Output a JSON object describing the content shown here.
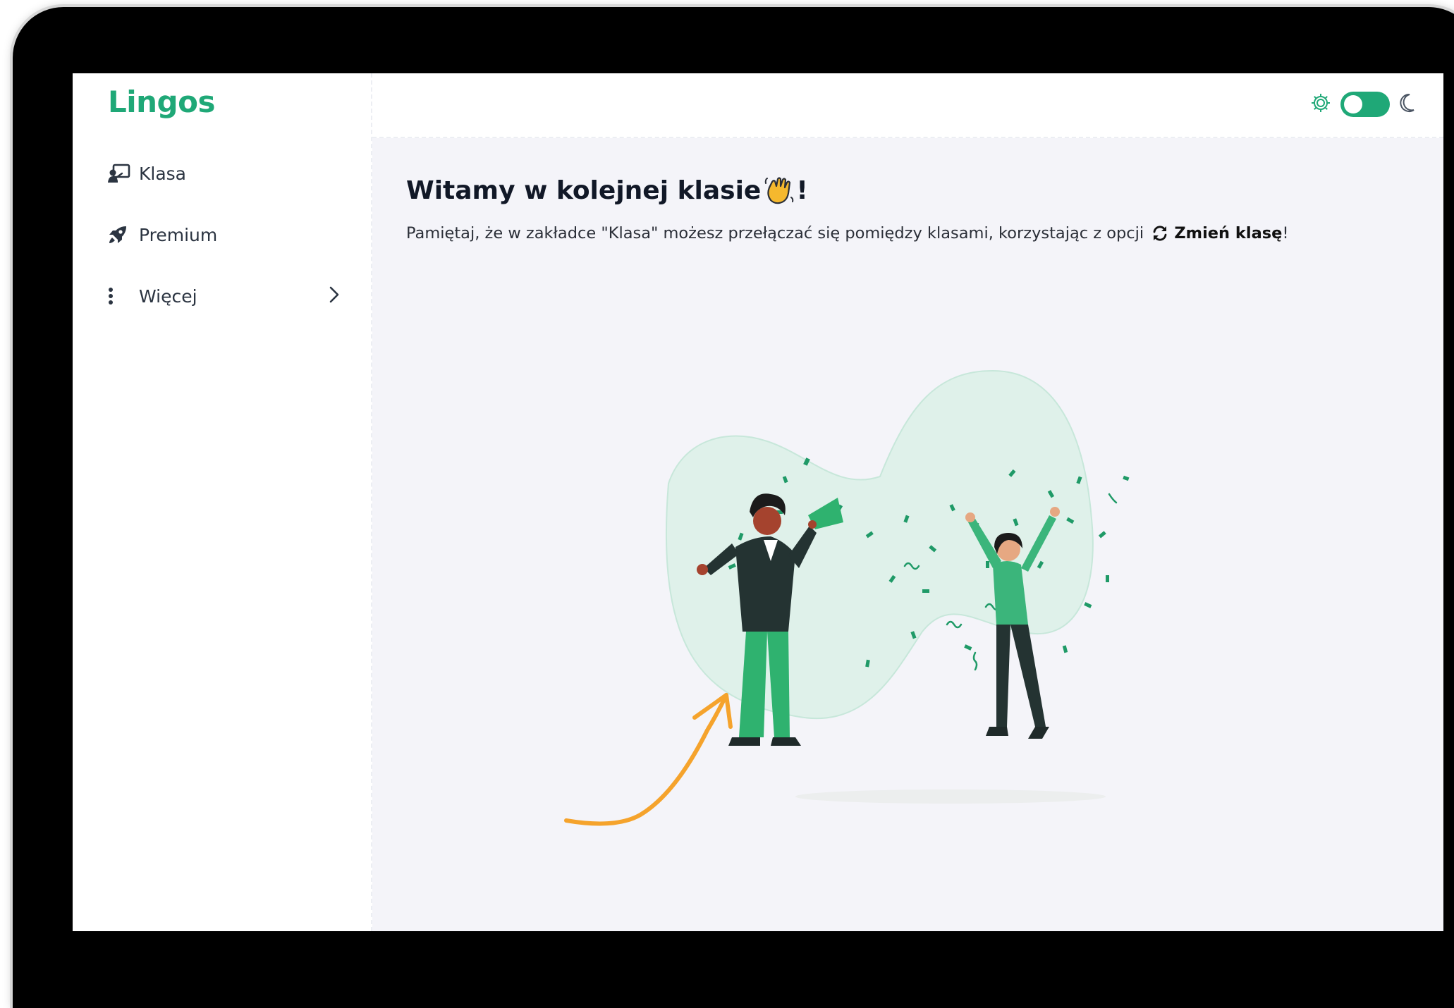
{
  "app": {
    "brand": "Lingos",
    "accent_color": "#1fa877"
  },
  "sidebar": {
    "items": [
      {
        "label": "Klasa",
        "icon": "classroom-icon"
      },
      {
        "label": "Premium",
        "icon": "rocket-icon"
      },
      {
        "label": "Więcej",
        "icon": "more-vertical-icon",
        "trailing_icon": "chevron-right-icon"
      }
    ]
  },
  "header": {
    "theme_toggle": {
      "left_icon": "sun-gear-icon",
      "right_icon": "moon-icon",
      "state": "on"
    }
  },
  "main": {
    "title": "Witamy w kolejnej klasie",
    "title_suffix": "!",
    "title_emoji": "waving-hand-icon",
    "message_prefix": "Pamiętaj, że w zakładce \"Klasa\" możesz przełączać się pomiędzy klasami, korzystając z opcji",
    "message_action_icon": "refresh-icon",
    "message_action": "Zmień klasę",
    "message_suffix": "!",
    "illustration": "celebration-illustration",
    "annotation": "orange-arrow"
  }
}
